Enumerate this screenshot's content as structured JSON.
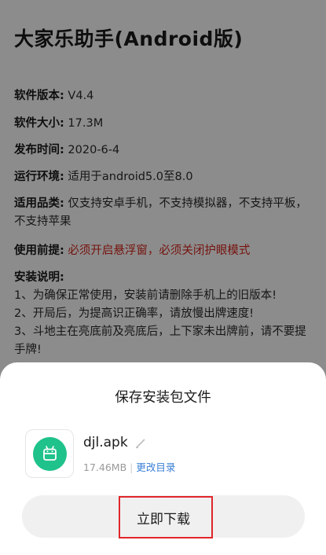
{
  "page": {
    "title": "大家乐助手(Android版)",
    "info": {
      "version_label": "软件版本:",
      "version_value": "V4.4",
      "size_label": "软件大小:",
      "size_value": "17.3M",
      "date_label": "发布时间:",
      "date_value": "2020-6-4",
      "env_label": "运行环境:",
      "env_value": "适用于android5.0至8.0",
      "fit_label": "适用品类:",
      "fit_value": "仅支持安卓手机，不支持模拟器，不支持平板，不支持苹果",
      "pre_label": "使用前提:",
      "pre_value": "必须开启悬浮窗，必须关闭护眼模式",
      "desc_label": "安装说明:",
      "desc_lines": [
        "1、为确保正常使用，安装前请删除手机上的旧版本!",
        "2、开局后，为提高识正确率，请放慢出牌速度!",
        "3、斗地主在亮底前及亮底后，上下家未出牌前，请不要提手牌!"
      ]
    }
  },
  "sheet": {
    "title": "保存安装包文件",
    "file_name": "djl.apk",
    "file_size": "17.46MB",
    "separator": "|",
    "change_dir": "更改目录",
    "download_label": "立即下载"
  },
  "icons": {
    "app_icon": "android-robot-icon",
    "edit_icon": "pencil-icon"
  },
  "colors": {
    "accent_green": "#1fc28a",
    "warning_red": "#d8261c",
    "link_blue": "#3a7fd6",
    "highlight_red": "#e0262a"
  }
}
